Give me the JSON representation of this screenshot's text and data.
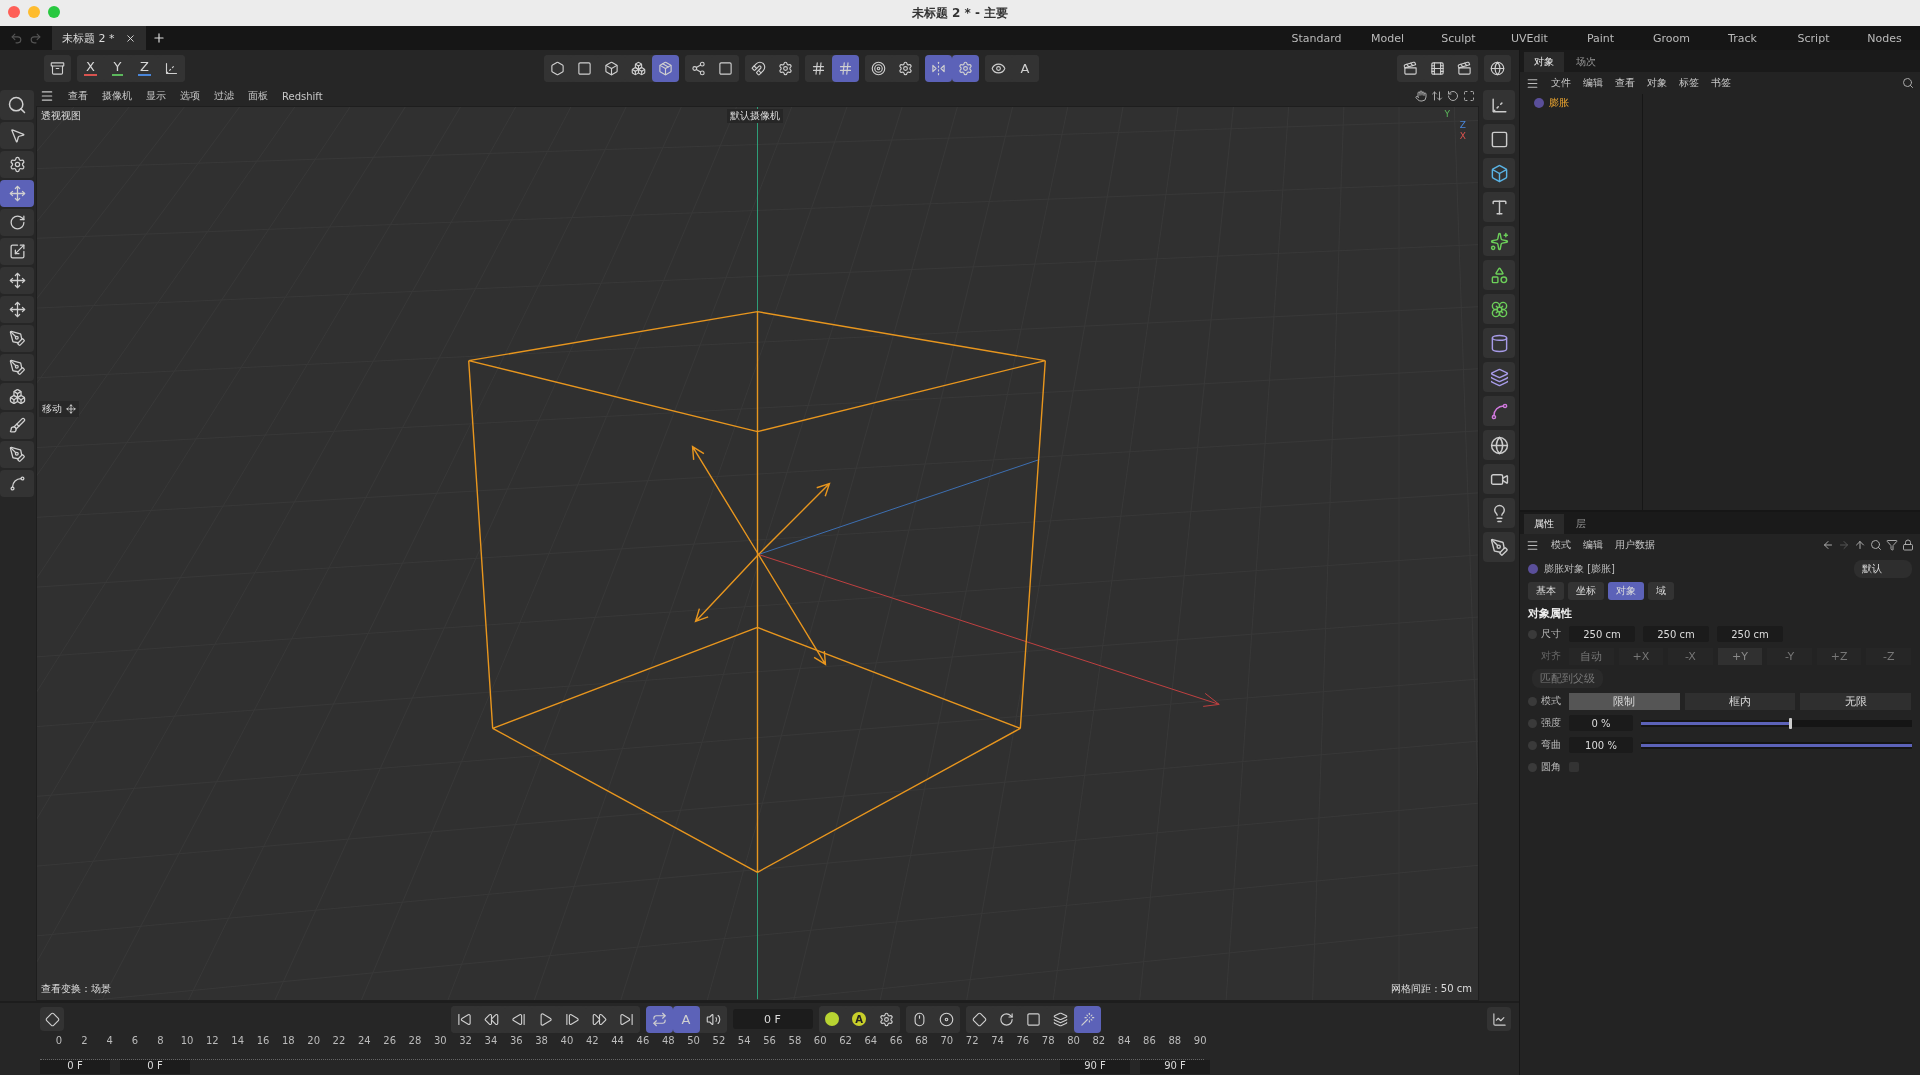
{
  "window": {
    "title": "未标题 2 * - 主要"
  },
  "doc_tabs": [
    {
      "label": "未标题 2 *",
      "selected": true
    }
  ],
  "layouts": [
    "Standard",
    "Model",
    "Sculpt",
    "UVEdit",
    "Paint",
    "Groom",
    "Track",
    "Script",
    "Nodes"
  ],
  "main_toolbar": {
    "left_groups": [
      [
        {
          "kind": "archive",
          "selected": false
        }
      ],
      [
        {
          "kind": "axis",
          "label": "X",
          "color": "#d9534f",
          "selected": false
        },
        {
          "kind": "axis",
          "label": "Y",
          "color": "#5cb85c",
          "selected": false
        },
        {
          "kind": "axis",
          "label": "Z",
          "color": "#4a86d9",
          "selected": false
        },
        {
          "kind": "axes",
          "selected": false
        }
      ]
    ],
    "center_groups": [
      [
        {
          "kind": "hexagon",
          "selected": false
        },
        {
          "kind": "square",
          "selected": false
        },
        {
          "kind": "box",
          "selected": false
        },
        {
          "kind": "boxes",
          "selected": false
        },
        {
          "kind": "package",
          "selected": true
        }
      ],
      [
        {
          "kind": "nodes",
          "selected": false
        },
        {
          "kind": "square",
          "selected": false
        }
      ],
      [
        {
          "kind": "magnet",
          "selected": false
        },
        {
          "kind": "gear",
          "selected": false
        }
      ],
      [
        {
          "kind": "grid",
          "selected": false
        },
        {
          "kind": "grid",
          "selected": true
        }
      ],
      [
        {
          "kind": "target",
          "selected": false
        },
        {
          "kind": "gear",
          "selected": false
        }
      ],
      [
        {
          "kind": "mirror",
          "selected": true
        },
        {
          "kind": "gear",
          "selected": true
        }
      ],
      [
        {
          "kind": "eye",
          "selected": false
        },
        {
          "kind": "letter",
          "label": "A",
          "selected": false
        }
      ]
    ],
    "right_groups": [
      [
        {
          "kind": "clapper",
          "selected": false
        },
        {
          "kind": "film",
          "selected": false
        },
        {
          "kind": "clapper",
          "selected": false
        }
      ],
      [
        {
          "kind": "globe",
          "selected": false
        }
      ]
    ]
  },
  "left_tools": [
    {
      "kind": "search",
      "selected": false
    },
    {
      "kind": "cursor",
      "selected": false
    },
    {
      "kind": "gear",
      "selected": false
    },
    {
      "kind": "move",
      "selected": true
    },
    {
      "kind": "rotate",
      "selected": false
    },
    {
      "kind": "scale",
      "selected": false
    },
    {
      "kind": "move",
      "selected": false
    },
    {
      "kind": "move",
      "selected": false
    },
    {
      "kind": "pen",
      "selected": false
    },
    {
      "kind": "pen",
      "selected": false
    },
    {
      "kind": "boxes",
      "selected": false
    },
    {
      "kind": "brush",
      "selected": false
    },
    {
      "kind": "pen",
      "selected": false
    },
    {
      "kind": "spline",
      "selected": false
    }
  ],
  "viewport_menu": [
    "查看",
    "摄像机",
    "显示",
    "选项",
    "过滤",
    "面板",
    "Redshift"
  ],
  "viewport": {
    "view_name": "透视视图",
    "camera": "默认摄像机",
    "tool_hint": "移动",
    "view_transform": "查看变换：场景",
    "grid_spacing": "网格间距 : 50 cm",
    "axis_labels": [
      "Y",
      "Z",
      "X"
    ]
  },
  "right_strip": [
    {
      "kind": "axes"
    },
    {
      "kind": "square"
    },
    {
      "kind": "box"
    },
    {
      "kind": "type"
    },
    {
      "kind": "sparkles"
    },
    {
      "kind": "shapes"
    },
    {
      "kind": "flower"
    },
    {
      "kind": "cylinder"
    },
    {
      "kind": "layers"
    },
    {
      "kind": "spline"
    },
    {
      "kind": "globe"
    },
    {
      "kind": "video"
    },
    {
      "kind": "light"
    },
    {
      "kind": "pen"
    }
  ],
  "timeline": {
    "key_button": {
      "kind": "diamond"
    },
    "groups": [
      [
        {
          "kind": "skip-back",
          "selected": false
        },
        {
          "kind": "rewind",
          "selected": false
        },
        {
          "kind": "step-back",
          "selected": false
        },
        {
          "kind": "play",
          "selected": false
        },
        {
          "kind": "step-forward",
          "selected": false
        },
        {
          "kind": "fast-forward",
          "selected": false
        },
        {
          "kind": "skip-forward",
          "selected": false
        }
      ],
      [
        {
          "kind": "repeat",
          "selected": true
        },
        {
          "kind": "letter",
          "label": "A",
          "selected": true
        },
        {
          "kind": "volume",
          "selected": false
        }
      ]
    ],
    "frame": "0 F",
    "record_groups": [
      [
        {
          "kind": "dot",
          "color": "#b8d432",
          "selected": false
        },
        {
          "kind": "letter-dot",
          "label": "A",
          "color": "#c8cf2a",
          "selected": false
        },
        {
          "kind": "gear",
          "selected": false
        }
      ],
      [
        {
          "kind": "mouse",
          "selected": false
        },
        {
          "kind": "record",
          "selected": false
        }
      ],
      [
        {
          "kind": "diamond",
          "selected": false
        },
        {
          "kind": "rotate",
          "selected": false
        },
        {
          "kind": "square",
          "selected": false
        },
        {
          "kind": "layers",
          "selected": false
        },
        {
          "kind": "wand",
          "selected": true
        }
      ]
    ],
    "ruler": [
      "0",
      "2",
      "4",
      "6",
      "8",
      "10",
      "12",
      "14",
      "16",
      "18",
      "20",
      "22",
      "24",
      "26",
      "28",
      "30",
      "32",
      "34",
      "36",
      "38",
      "40",
      "42",
      "44",
      "46",
      "48",
      "50",
      "52",
      "54",
      "56",
      "58",
      "60",
      "62",
      "64",
      "66",
      "68",
      "70",
      "72",
      "74",
      "76",
      "78",
      "80",
      "82",
      "84",
      "86",
      "88",
      "90"
    ],
    "range": [
      "0 F",
      "0 F",
      "90 F",
      "90 F"
    ],
    "graph_button": {
      "kind": "chart"
    }
  },
  "objects_panel": {
    "tabs": [
      {
        "label": "对象",
        "selected": true
      },
      {
        "label": "场次",
        "selected": false
      }
    ],
    "menu": [
      "文件",
      "编辑",
      "查看",
      "对象",
      "标签",
      "书签"
    ],
    "tree": [
      {
        "label": "膨胀",
        "selected": true
      }
    ]
  },
  "attributes_panel": {
    "tabs": [
      {
        "label": "属性",
        "selected": true
      },
      {
        "label": "层",
        "selected": false
      }
    ],
    "menu": [
      "模式",
      "编辑",
      "用户数据"
    ],
    "object_title": "膨胀对象 [膨胀]",
    "preset": "默认",
    "sub_tabs": [
      {
        "label": "基本",
        "selected": false
      },
      {
        "label": "坐标",
        "selected": false
      },
      {
        "label": "对象",
        "selected": true
      },
      {
        "label": "域",
        "selected": false
      }
    ],
    "section": "对象属性",
    "size": {
      "label": "尺寸",
      "values": [
        "250 cm",
        "250 cm",
        "250 cm"
      ]
    },
    "align": {
      "label": "对齐",
      "disabled": true,
      "options": [
        {
          "label": "自动",
          "selected": false
        },
        {
          "label": "+X",
          "selected": false
        },
        {
          "label": "-X",
          "selected": false
        },
        {
          "label": "+Y",
          "selected": true
        },
        {
          "label": "-Y",
          "selected": false
        },
        {
          "label": "+Z",
          "selected": false
        },
        {
          "label": "-Z",
          "selected": false
        }
      ]
    },
    "fit_button": {
      "label": "匹配到父级",
      "disabled": true
    },
    "mode": {
      "label": "模式",
      "options": [
        {
          "label": "限制",
          "selected": true
        },
        {
          "label": "框内",
          "selected": false
        },
        {
          "label": "无限",
          "selected": false
        }
      ]
    },
    "sliders": [
      {
        "label": "强度",
        "reading": "0 %",
        "level": 0.55
      },
      {
        "label": "弯曲",
        "reading": "100 %",
        "level": 1
      }
    ],
    "rounding": {
      "label": "圆角",
      "checked": false
    }
  }
}
